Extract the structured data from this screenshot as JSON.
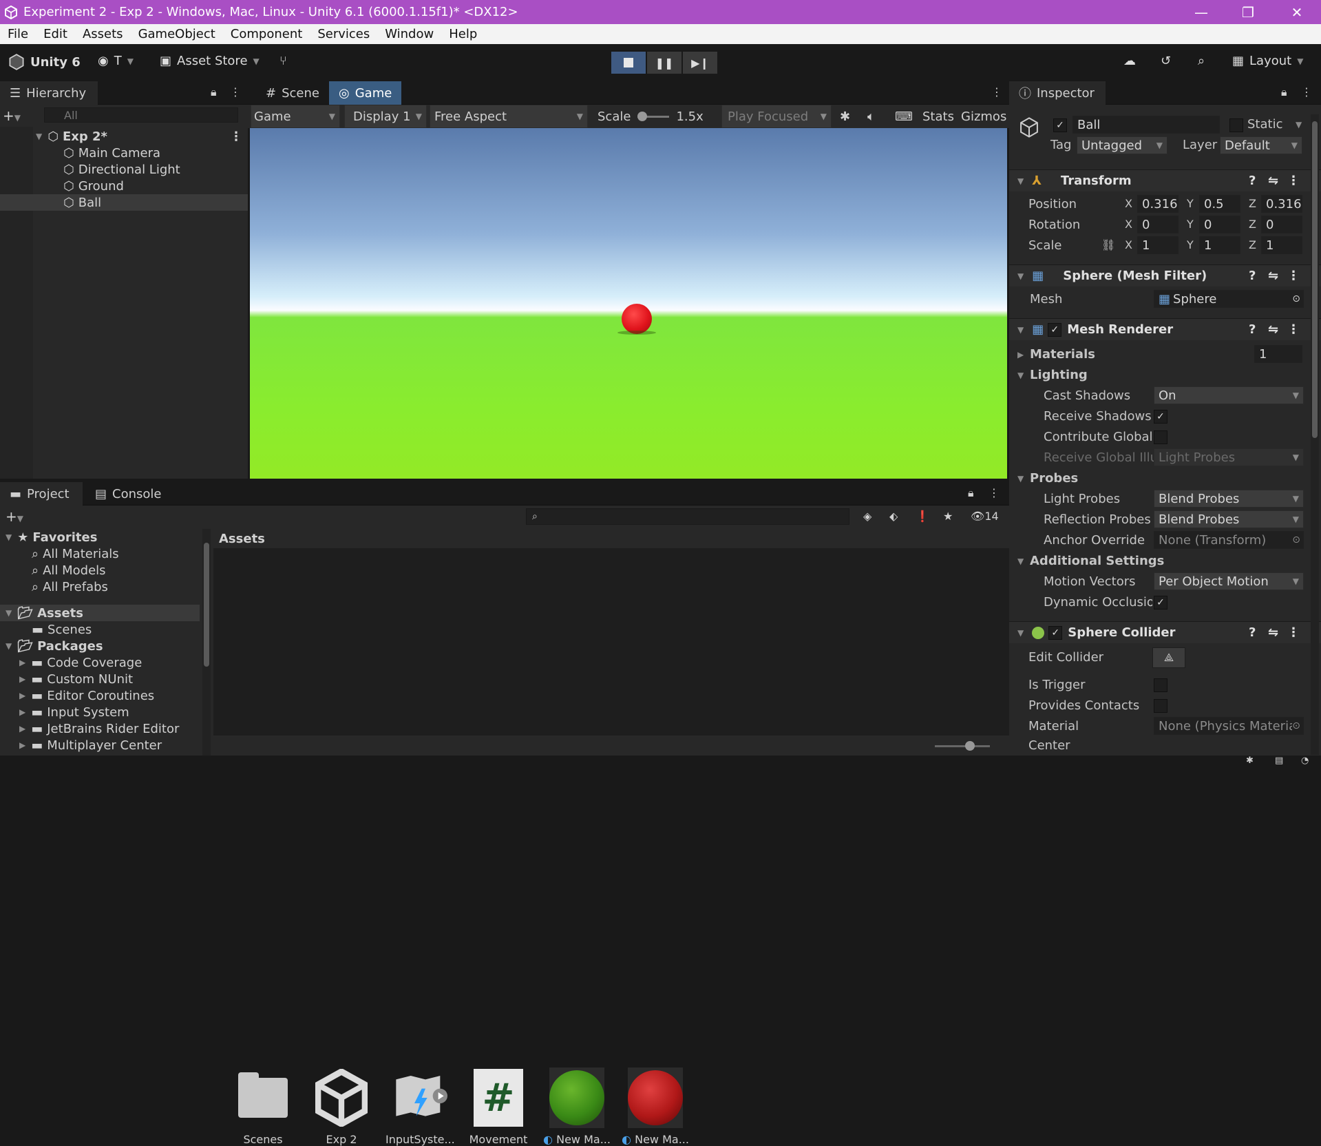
{
  "window": {
    "title": "Experiment 2 - Exp 2 - Windows, Mac, Linux - Unity 6.1 (6000.1.15f1)* <DX12>"
  },
  "menu": [
    "File",
    "Edit",
    "Assets",
    "GameObject",
    "Component",
    "Services",
    "Window",
    "Help"
  ],
  "toolbar": {
    "unity_label": "Unity 6",
    "account": "T",
    "asset_store": "Asset Store",
    "layout": "Layout"
  },
  "hierarchy": {
    "tab": "Hierarchy",
    "search_placeholder": "All",
    "scene": "Exp 2*",
    "items": [
      "Main Camera",
      "Directional Light",
      "Ground",
      "Ball"
    ],
    "selected": "Ball"
  },
  "view_tabs": {
    "scene": "Scene",
    "game": "Game"
  },
  "game_toolbar": {
    "mode": "Game",
    "display": "Display 1",
    "aspect": "Free Aspect",
    "scale_label": "Scale",
    "scale_value": "1.5x",
    "play_focused": "Play Focused",
    "stats": "Stats",
    "gizmos": "Gizmos"
  },
  "inspector": {
    "tab": "Inspector",
    "object_name": "Ball",
    "static_label": "Static",
    "tag_label": "Tag",
    "tag_value": "Untagged",
    "layer_label": "Layer",
    "layer_value": "Default",
    "transform": {
      "title": "Transform",
      "position_label": "Position",
      "rotation_label": "Rotation",
      "scale_label": "Scale",
      "position": {
        "x": "0.3168",
        "y": "0.5",
        "z": "0.3168"
      },
      "rotation": {
        "x": "0",
        "y": "0",
        "z": "0"
      },
      "scale": {
        "x": "1",
        "y": "1",
        "z": "1"
      }
    },
    "mesh_filter": {
      "title": "Sphere (Mesh Filter)",
      "mesh_label": "Mesh",
      "mesh_value": "Sphere"
    },
    "mesh_renderer": {
      "title": "Mesh Renderer",
      "materials_label": "Materials",
      "materials_count": "1",
      "lighting": "Lighting",
      "cast_shadows_label": "Cast Shadows",
      "cast_shadows_value": "On",
      "receive_shadows_label": "Receive Shadows",
      "contribute_gi_label": "Contribute Global",
      "receive_gi_label": "Receive Global Illu",
      "receive_gi_value": "Light Probes",
      "probes": "Probes",
      "light_probes_label": "Light Probes",
      "light_probes_value": "Blend Probes",
      "reflection_probes_label": "Reflection Probes",
      "reflection_probes_value": "Blend Probes",
      "anchor_override_label": "Anchor Override",
      "anchor_override_value": "None (Transform)",
      "additional": "Additional Settings",
      "motion_vectors_label": "Motion Vectors",
      "motion_vectors_value": "Per Object Motion",
      "dynamic_occlusion_label": "Dynamic Occlusior"
    },
    "sphere_collider": {
      "title": "Sphere Collider",
      "edit_collider_label": "Edit Collider",
      "is_trigger_label": "Is Trigger",
      "provides_contacts_label": "Provides Contacts",
      "material_label": "Material",
      "material_value": "None (Physics Materia",
      "center_label": "Center"
    }
  },
  "project": {
    "tab": "Project",
    "console_tab": "Console",
    "hidden_count": "14",
    "breadcrumb": "Assets",
    "tree": {
      "favorites": "Favorites",
      "fav_items": [
        "All Materials",
        "All Models",
        "All Prefabs"
      ],
      "assets": "Assets",
      "asset_children": [
        "Scenes"
      ],
      "packages": "Packages",
      "package_items": [
        "Code Coverage",
        "Custom NUnit",
        "Editor Coroutines",
        "Input System",
        "JetBrains Rider Editor",
        "Multiplayer Center"
      ]
    },
    "assets": [
      "Scenes",
      "Exp 2",
      "InputSyste...",
      "Movement",
      "New Ma...",
      "New Ma..."
    ]
  },
  "colors": {
    "titlebar": "#a94fc4",
    "accent": "#3a5d82",
    "ground": "#8aec2e",
    "ball": "#e0141c"
  }
}
